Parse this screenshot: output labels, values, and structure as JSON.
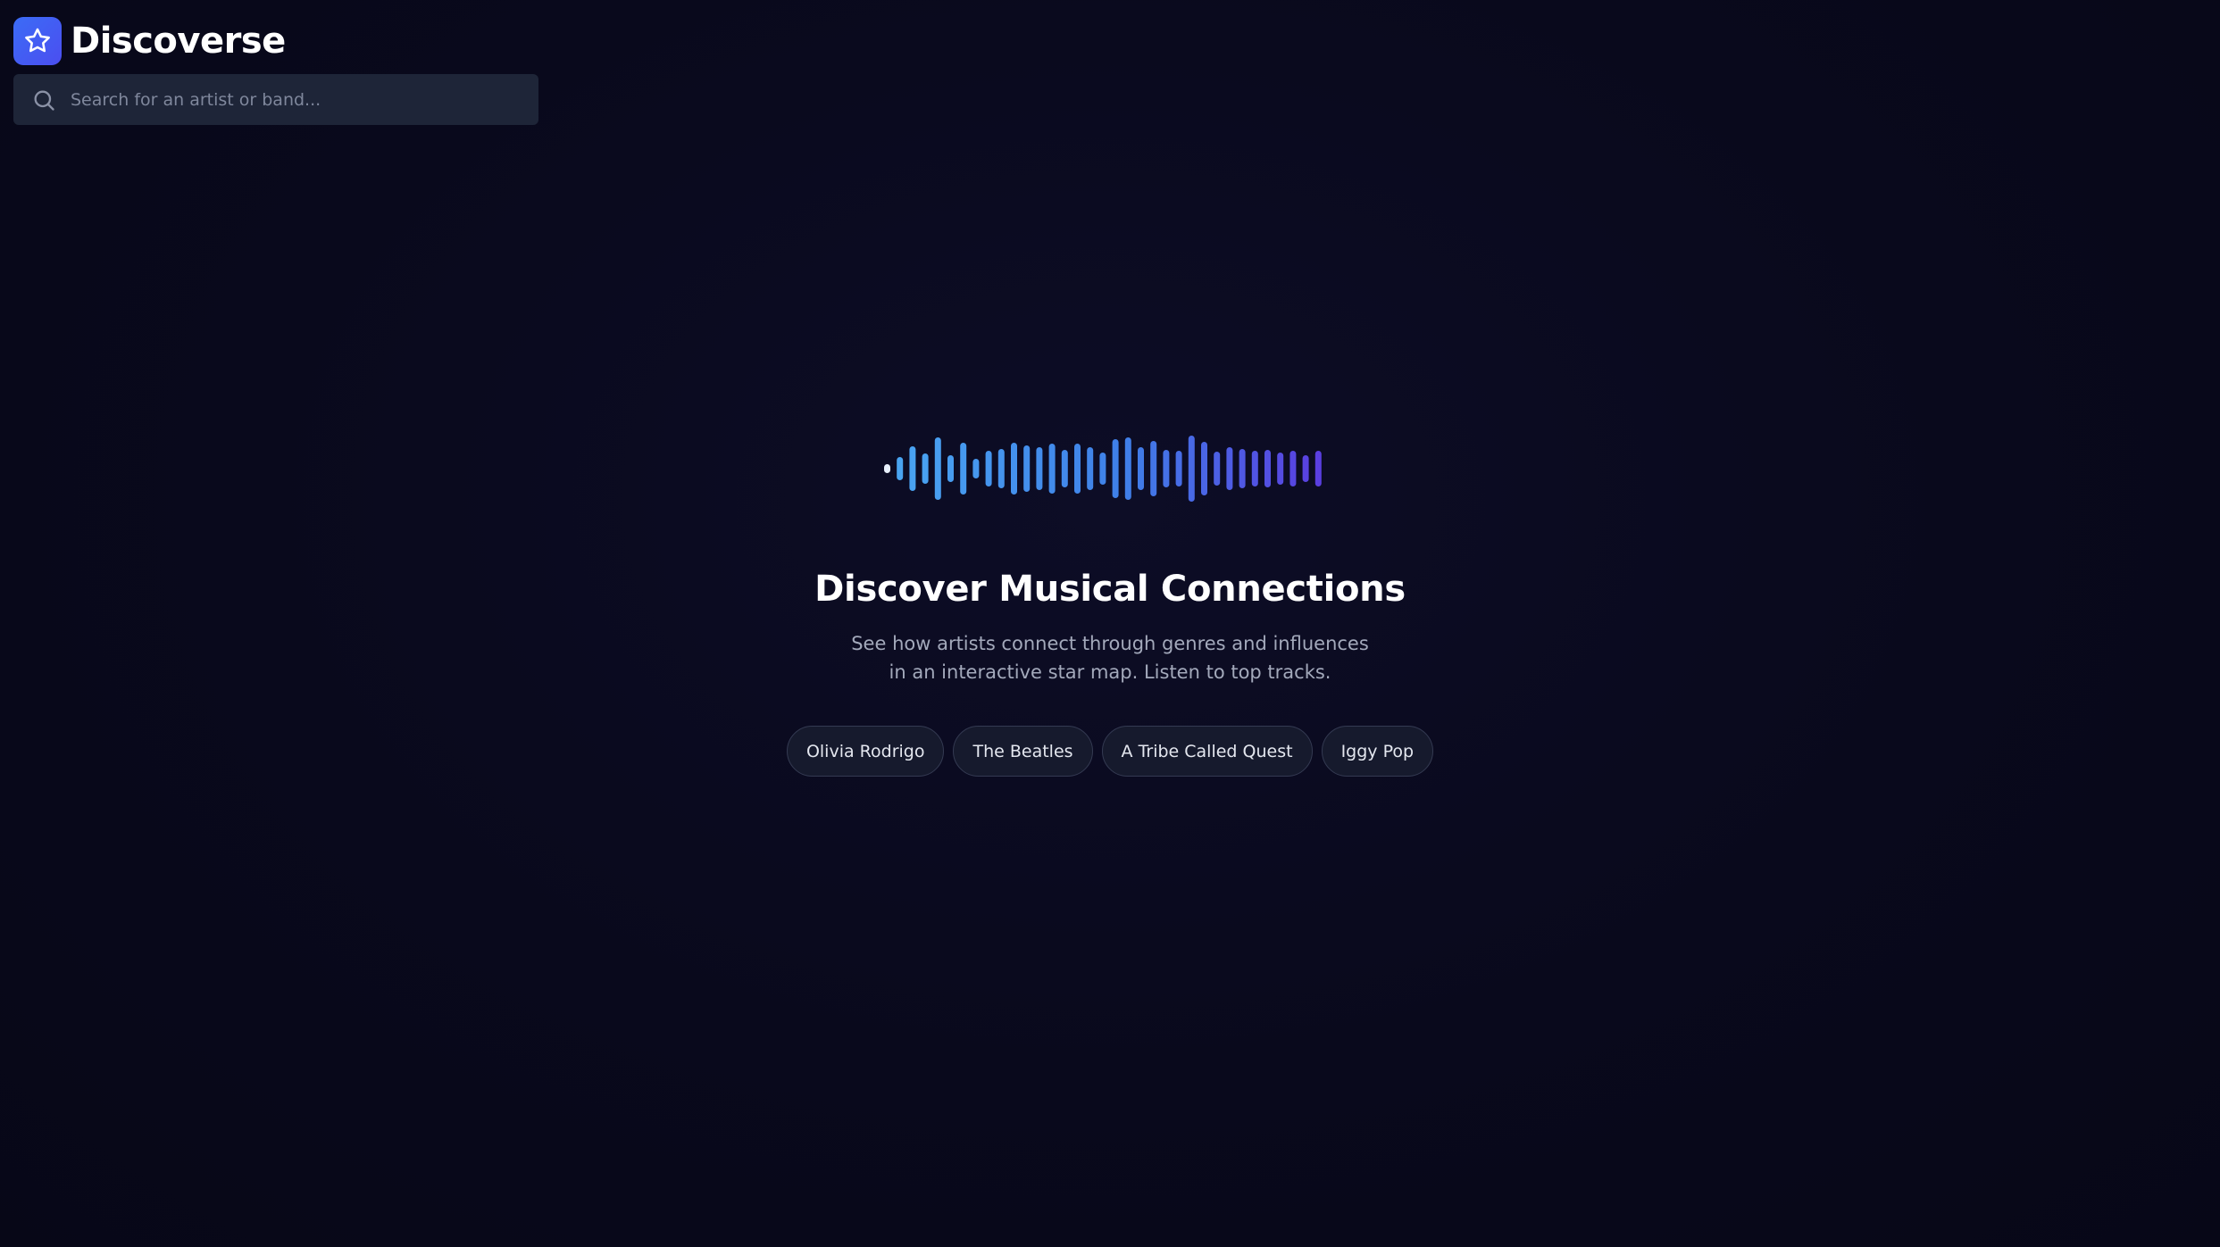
{
  "app": {
    "name": "Discoverse",
    "logo_icon": "star-icon",
    "accent": "#4458f0"
  },
  "search": {
    "placeholder": "Search for an artist or band...",
    "value": "",
    "icon": "search-icon"
  },
  "hero": {
    "graphic": "waveform",
    "title": "Discover Musical Connections",
    "subtitle": "See how artists connect through genres and influences in an interactive star map. Listen to top tracks.",
    "suggestions": [
      "Olivia Rodrigo",
      "The Beatles",
      "A Tribe Called Quest",
      "Iggy Pop"
    ]
  },
  "colors": {
    "background": "#0a0a1e",
    "wave_start": "#4aa6f2",
    "wave_end": "#5a3fe0"
  }
}
